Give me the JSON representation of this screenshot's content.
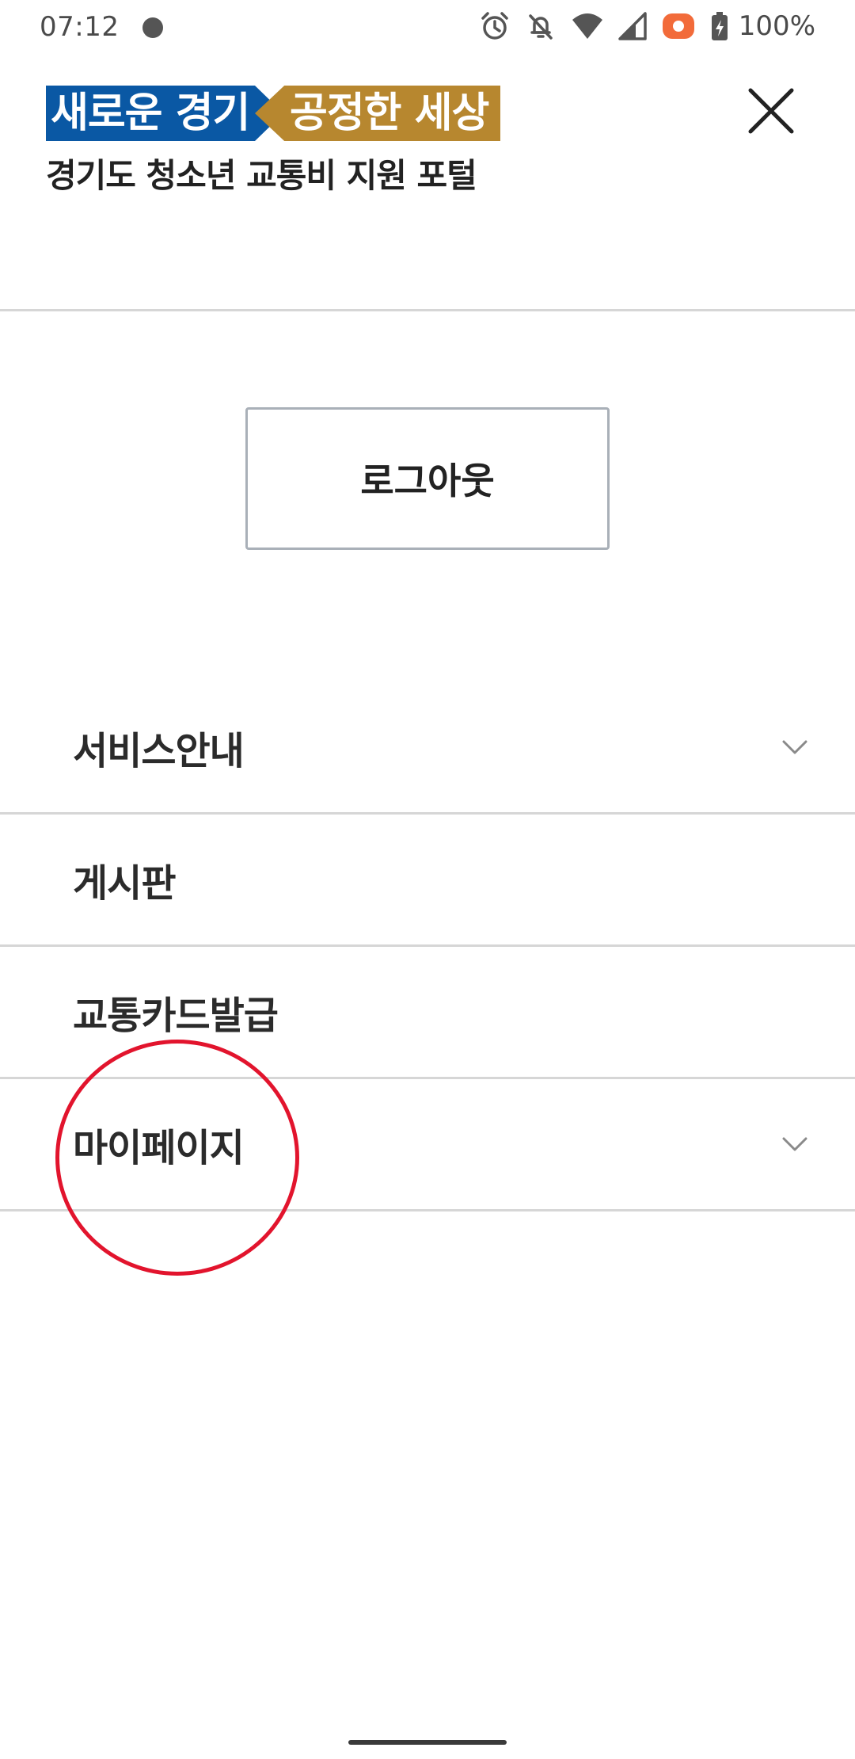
{
  "status_bar": {
    "time": "07:12",
    "battery": "100%",
    "icons": [
      "notification-dot-icon",
      "alarm-icon",
      "bell-off-icon",
      "wifi-icon",
      "signal-icon",
      "record-icon",
      "battery-charging-icon"
    ],
    "colors": {
      "record": "#f26b3a",
      "text": "#4a4a4a"
    }
  },
  "header": {
    "slogan_left": "새로운 경기",
    "slogan_right": "공정한 세상",
    "subtitle": "경기도 청소년 교통비 지원 포털",
    "colors": {
      "slogan_left_bg": "#0a58a4",
      "slogan_right_bg": "#b7872f"
    },
    "close_icon": "close-icon"
  },
  "logout": {
    "label": "로그아웃"
  },
  "menu": {
    "items": [
      {
        "label": "서비스안내",
        "expandable": true
      },
      {
        "label": "게시판",
        "expandable": false
      },
      {
        "label": "교통카드발급",
        "expandable": false
      },
      {
        "label": "마이페이지",
        "expandable": true
      }
    ]
  },
  "annotation": {
    "color": "#e2142d",
    "target": "마이페이지"
  }
}
